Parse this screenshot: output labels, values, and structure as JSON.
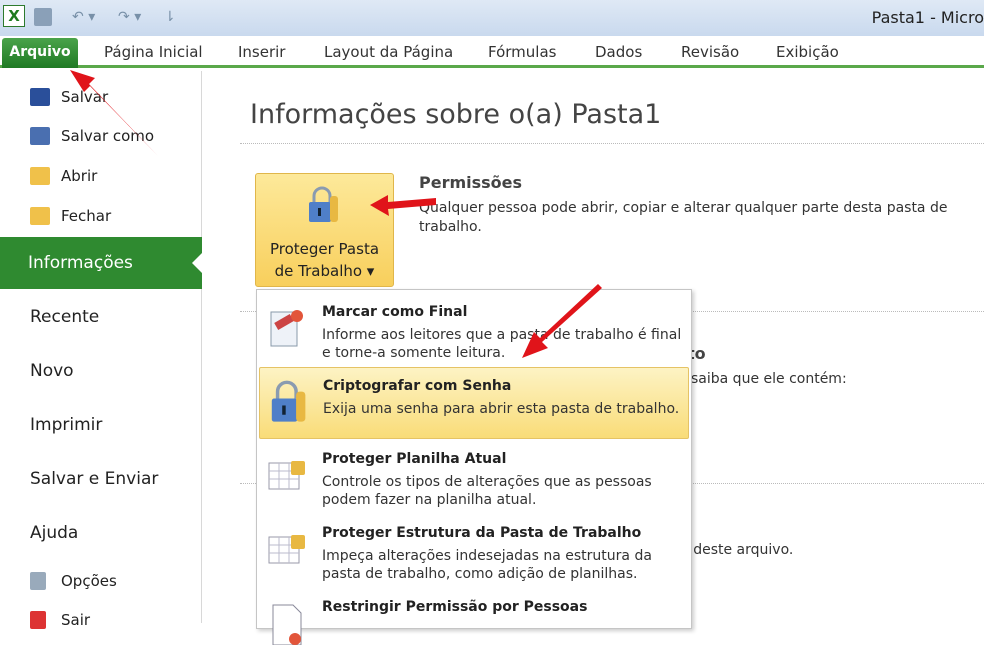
{
  "window": {
    "title": "Pasta1 - Micro"
  },
  "qat": {
    "undo": "↶",
    "redo": "↷",
    "dropdown": "▾",
    "customize": "⇂"
  },
  "ribbon": {
    "tabs": [
      "Arquivo",
      "Página Inicial",
      "Inserir",
      "Layout da Página",
      "Fórmulas",
      "Dados",
      "Revisão",
      "Exibição"
    ]
  },
  "sidebar": {
    "commands": [
      "Salvar",
      "Salvar como",
      "Abrir",
      "Fechar"
    ],
    "selected": "Informações",
    "sections": [
      "Recente",
      "Novo",
      "Imprimir",
      "Salvar e Enviar",
      "Ajuda"
    ],
    "bottom": [
      "Opções",
      "Sair"
    ]
  },
  "main": {
    "heading": "Informações sobre o(a) Pasta1",
    "protect_button": {
      "line1": "Proteger Pasta",
      "line2": "de Trabalho ▾"
    },
    "permissions": {
      "title": "Permissões",
      "text": "Qualquer pessoa pode abrir, copiar e alterar qualquer parte desta pasta de trabalho."
    },
    "fragments": [
      "to",
      "saiba que ele contém:",
      "r deste arquivo."
    ]
  },
  "menu": {
    "items": [
      {
        "title": "Marcar como Final",
        "desc": "Informe aos leitores que a pasta de trabalho é final e torne-a somente leitura."
      },
      {
        "title": "Criptografar com Senha",
        "desc": "Exija uma senha para abrir esta pasta de trabalho."
      },
      {
        "title": "Proteger Planilha Atual",
        "desc": "Controle os tipos de alterações que as pessoas podem fazer na planilha atual."
      },
      {
        "title": "Proteger Estrutura da Pasta de Trabalho",
        "desc": "Impeça alterações indesejadas na estrutura da pasta de trabalho, como adição de planilhas."
      },
      {
        "title": "Restringir Permissão por Pessoas",
        "desc": ""
      }
    ]
  },
  "colors": {
    "accent": "#2f8a30",
    "highlight": "#f9dc78",
    "arrow": "#e0141a"
  }
}
